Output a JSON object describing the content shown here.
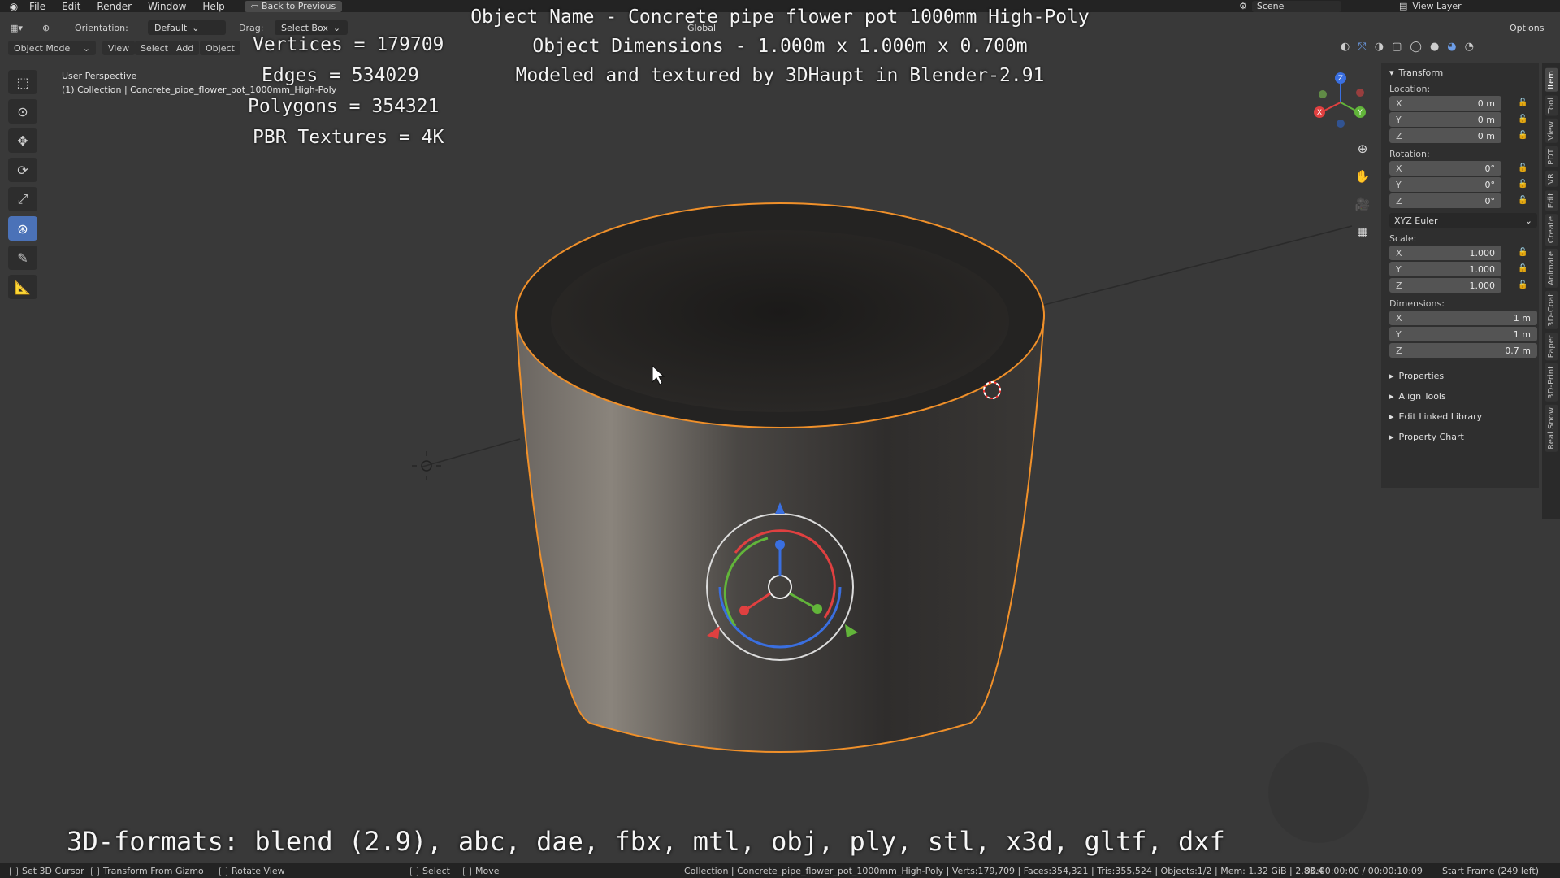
{
  "menubar": {
    "items": [
      "File",
      "Edit",
      "Render",
      "Window",
      "Help"
    ],
    "back_button": "Back to Previous",
    "scene_label": "Scene",
    "view_layer_label": "View Layer"
  },
  "toolbar": {
    "orientation_label": "Orientation:",
    "orientation_value": "Default",
    "drag_label": "Drag:",
    "drag_value": "Select Box",
    "transform_orientation": "Global",
    "options_label": "Options"
  },
  "header": {
    "mode": "Object Mode",
    "menus": [
      "View",
      "Select",
      "Add",
      "Object"
    ]
  },
  "viewport": {
    "perspective": "User Perspective",
    "collection": "(1) Collection | Concrete_pipe_flower_pot_1000mm_High-Poly"
  },
  "overlay": {
    "vertices": "Vertices = 179709",
    "edges": "Edges = 534029",
    "polygons": "Polygons = 354321",
    "textures": "PBR Textures = 4K",
    "object_name": "Object Name - Concrete pipe flower pot 1000mm High-Poly",
    "object_dims": "Object Dimensions -  1.000m x 1.000m x 0.700m",
    "credits": "Modeled and textured by 3DHaupt in Blender-2.91",
    "formats": "3D-formats: blend (2.9), abc, dae, fbx, mtl, obj, ply, stl, x3d, gltf, dxf"
  },
  "npanel": {
    "transform_title": "Transform",
    "location_label": "Location:",
    "location": {
      "x": "0 m",
      "y": "0 m",
      "z": "0 m"
    },
    "rotation_label": "Rotation:",
    "rotation": {
      "x": "0°",
      "y": "0°",
      "z": "0°"
    },
    "rotation_mode": "XYZ Euler",
    "scale_label": "Scale:",
    "scale": {
      "x": "1.000",
      "y": "1.000",
      "z": "1.000"
    },
    "dimensions_label": "Dimensions:",
    "dimensions": {
      "x": "1 m",
      "y": "1 m",
      "z": "0.7 m"
    },
    "axis": {
      "x": "X",
      "y": "Y",
      "z": "Z"
    },
    "subpanels": [
      "Properties",
      "Align Tools",
      "Edit Linked Library",
      "Property Chart"
    ]
  },
  "sidetabs": [
    "Item",
    "Tool",
    "View",
    "PDT",
    "VR",
    "Edit",
    "Create",
    "Animate",
    "3D-Coat",
    "Paper",
    "3D-Print",
    "Real Snow"
  ],
  "statusbar": {
    "set_cursor": "Set 3D Cursor",
    "transform_gizmo": "Transform From Gizmo",
    "rotate_view": "Rotate View",
    "select": "Select",
    "move": "Move",
    "stats": "Collection | Concrete_pipe_flower_pot_1000mm_High-Poly | Verts:179,709 | Faces:354,321 | Tris:355,524 | Objects:1/2 | Mem: 1.32 GiB | 2.83.4",
    "time": "00:00:00:00 / 00:00:10:09",
    "frame": "Start Frame (249 left)"
  },
  "colors": {
    "accent": "#4b72b8",
    "selection": "#f0902a",
    "viewport_bg": "#393939"
  }
}
